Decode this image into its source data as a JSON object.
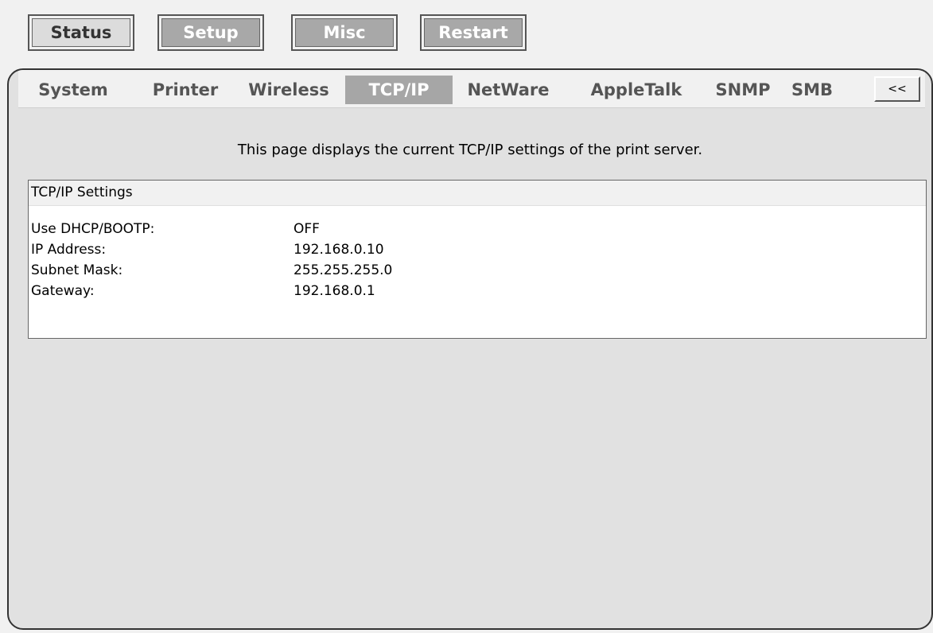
{
  "top_nav": {
    "status": "Status",
    "setup": "Setup",
    "misc": "Misc",
    "restart": "Restart"
  },
  "tabs": [
    {
      "label": "System"
    },
    {
      "label": "Printer"
    },
    {
      "label": "Wireless"
    },
    {
      "label": "TCP/IP",
      "active": true
    },
    {
      "label": "NetWare"
    },
    {
      "label": "AppleTalk"
    },
    {
      "label": "SNMP"
    },
    {
      "label": "SMB"
    }
  ],
  "collapse_label": "<<",
  "description": "This page displays the current TCP/IP settings of the print server.",
  "settings": {
    "title": "TCP/IP Settings",
    "rows": [
      {
        "label": "Use DHCP/BOOTP:",
        "value": "OFF"
      },
      {
        "label": "IP Address:",
        "value": "192.168.0.10"
      },
      {
        "label": "Subnet Mask:",
        "value": "255.255.255.0"
      },
      {
        "label": "Gateway:",
        "value": "192.168.0.1"
      }
    ]
  },
  "colors": {
    "active_tab": "#a6a6a6",
    "panel_bg": "#e1e1e1",
    "page_bg": "#f1f1f1"
  }
}
